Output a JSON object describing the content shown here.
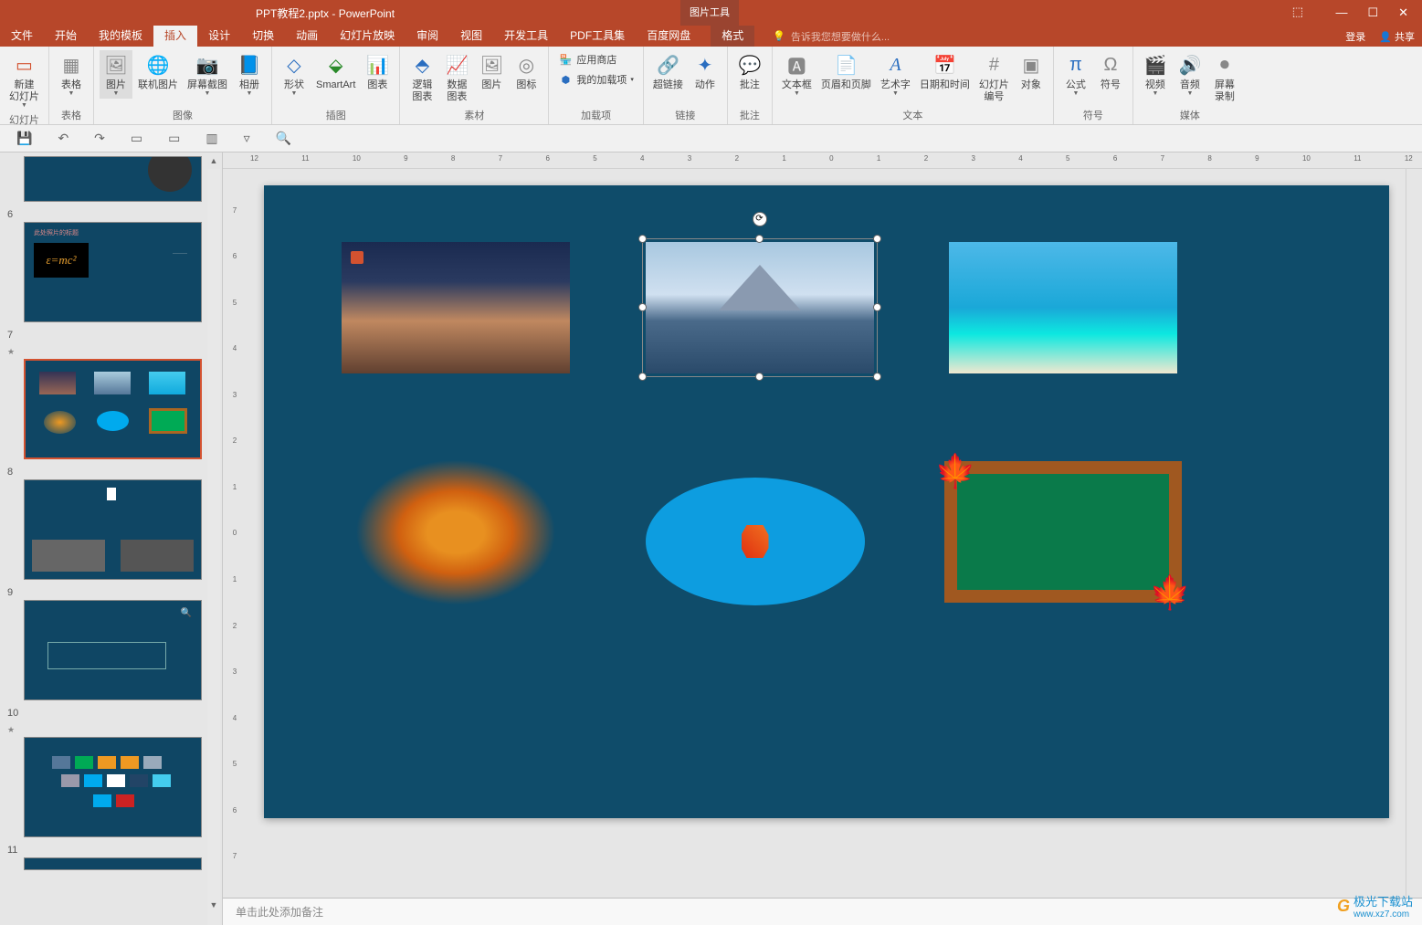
{
  "title": "PPT教程2.pptx - PowerPoint",
  "context_tab_group": "图片工具",
  "context_tab": "格式",
  "window": {
    "login": "登录",
    "share": "共享"
  },
  "tabs": [
    "文件",
    "开始",
    "我的模板",
    "插入",
    "设计",
    "切换",
    "动画",
    "幻灯片放映",
    "审阅",
    "视图",
    "开发工具",
    "PDF工具集",
    "百度网盘"
  ],
  "active_tab": "插入",
  "tell_me": "告诉我您想要做什么...",
  "ribbon": {
    "g1": {
      "label": "幻灯片",
      "new_slide": "新建\n幻灯片"
    },
    "g2": {
      "label": "表格",
      "table": "表格"
    },
    "g3": {
      "label": "图像",
      "picture": "图片",
      "online_pic": "联机图片",
      "screenshot": "屏幕截图",
      "album": "相册"
    },
    "g4": {
      "label": "插图",
      "shapes": "形状",
      "smartart": "SmartArt",
      "chart": "图表"
    },
    "g5": {
      "label": "素材",
      "logic_chart": "逻辑\n图表",
      "data_chart": "数据\n图表",
      "pic": "图片",
      "icon": "图标"
    },
    "g6": {
      "label": "加载项",
      "store": "应用商店",
      "myaddins": "我的加载项"
    },
    "g7": {
      "label": "链接",
      "hyperlink": "超链接",
      "action": "动作"
    },
    "g8": {
      "label": "批注",
      "comment": "批注"
    },
    "g9": {
      "label": "文本",
      "textbox": "文本框",
      "header": "页眉和页脚",
      "wordart": "艺术字",
      "datetime": "日期和时间",
      "slidenum": "幻灯片\n编号",
      "object": "对象"
    },
    "g10": {
      "label": "符号",
      "equation": "公式",
      "symbol": "符号"
    },
    "g11": {
      "label": "媒体",
      "video": "视频",
      "audio": "音频",
      "screenrec": "屏幕\n录制"
    }
  },
  "thumbs": {
    "s6": {
      "num": "6",
      "title": "此处照片的标题",
      "formula": "ε=mc²"
    },
    "s7": {
      "num": "7"
    },
    "s8": {
      "num": "8"
    },
    "s9": {
      "num": "9"
    },
    "s10": {
      "num": "10"
    },
    "s11": {
      "num": "11"
    }
  },
  "ruler_marks": [
    "12",
    "11",
    "10",
    "9",
    "8",
    "7",
    "6",
    "5",
    "4",
    "3",
    "2",
    "1",
    "0",
    "1",
    "2",
    "3",
    "4",
    "5",
    "6",
    "7",
    "8",
    "9",
    "10",
    "11",
    "12"
  ],
  "ruler_v": [
    "7",
    "6",
    "5",
    "4",
    "3",
    "2",
    "1",
    "0",
    "1",
    "2",
    "3",
    "4",
    "5",
    "6",
    "7"
  ],
  "notes_placeholder": "单击此处添加备注",
  "watermark": {
    "name": "极光下载站",
    "url": "www.xz7.com"
  }
}
